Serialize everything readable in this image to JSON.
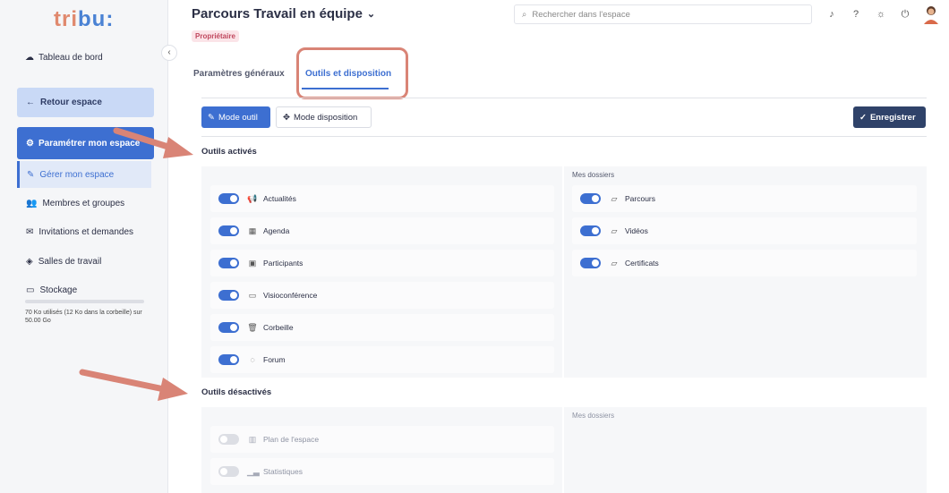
{
  "app": {
    "logo_part1": "tri",
    "logo_part2": "bu:"
  },
  "sidebar": {
    "dashboard": "Tableau de bord",
    "back": "Retour espace",
    "configure": "Paramétrer mon espace",
    "items": [
      {
        "label": "Gérer mon espace",
        "icon": "wrench-icon"
      },
      {
        "label": "Membres et groupes",
        "icon": "users-icon"
      },
      {
        "label": "Invitations et demandes",
        "icon": "mail-icon"
      },
      {
        "label": "Salles de travail",
        "icon": "cube-icon"
      },
      {
        "label": "Stockage",
        "icon": "folder-icon"
      }
    ],
    "storage_used_fraction": 0,
    "storage_text": "70 Ko utilisés (12 Ko dans la corbeille) sur 50.00 Go"
  },
  "header": {
    "title": "Parcours Travail en équipe",
    "badge": "Propriétaire",
    "search_placeholder": "Rechercher dans l'espace"
  },
  "tabs": [
    {
      "label": "Paramètres généraux"
    },
    {
      "label": "Outils et disposition"
    }
  ],
  "toolbar": {
    "mode_tool": "Mode outil",
    "mode_layout": "Mode disposition",
    "save": "Enregistrer"
  },
  "active_section": {
    "title": "Outils activés",
    "tools": [
      {
        "label": "Actualités",
        "icon": "megaphone-icon",
        "enabled": true
      },
      {
        "label": "Agenda",
        "icon": "calendar-icon",
        "enabled": true
      },
      {
        "label": "Participants",
        "icon": "contact-icon",
        "enabled": true
      },
      {
        "label": "Visioconférence",
        "icon": "video-icon",
        "enabled": true
      },
      {
        "label": "Corbeille",
        "icon": "trash-icon",
        "enabled": true
      },
      {
        "label": "Forum",
        "icon": "chat-icon",
        "enabled": true
      }
    ],
    "folders_title": "Mes dossiers",
    "folders": [
      {
        "label": "Parcours",
        "enabled": true
      },
      {
        "label": "Vidéos",
        "enabled": true
      },
      {
        "label": "Certificats",
        "enabled": true
      }
    ]
  },
  "disabled_section": {
    "title": "Outils désactivés",
    "tools": [
      {
        "label": "Plan de l'espace",
        "icon": "map-icon",
        "enabled": false
      },
      {
        "label": "Statistiques",
        "icon": "chart-icon",
        "enabled": false
      }
    ],
    "folders_title": "Mes dossiers"
  },
  "colors": {
    "primary": "#3d6fd1",
    "save_button": "#2f4269",
    "highlight": "#d98476",
    "badge": "#c0485e"
  }
}
